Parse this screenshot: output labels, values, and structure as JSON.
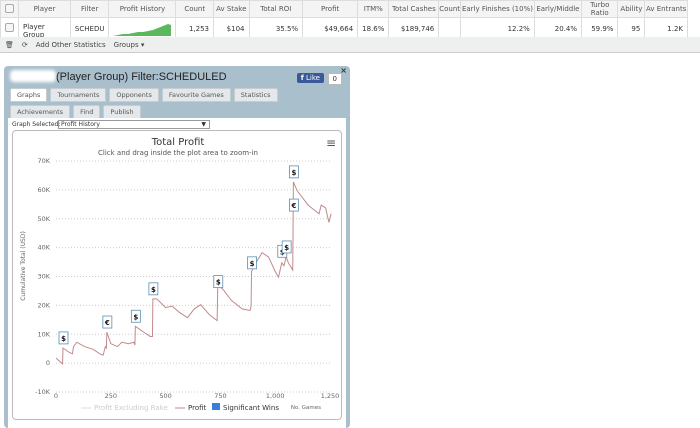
{
  "table": {
    "headers": [
      "",
      "Player",
      "Filter",
      "Profit History",
      "Count",
      "Av Stake",
      "Total ROI",
      "Profit",
      "ITM%",
      "Total Cashes",
      "Count",
      "Early Finishes (10%)",
      "Early/Middle",
      "Turbo Ratio",
      "Ability",
      "Av Entrants"
    ],
    "row": [
      "",
      "Player Group",
      "SCHEDU",
      "",
      "1,253",
      "$104",
      "35.5%",
      "$49,664",
      "18.6%",
      "$189,746",
      "",
      "12.2%",
      "20.4%",
      "59.9%",
      "95",
      "1.2K"
    ]
  },
  "toolbar": {
    "add_stats": "Add Other Statistics",
    "groups": "Groups ▾"
  },
  "popup": {
    "title": "(Player Group) Filter:SCHEDULED",
    "like": "Like",
    "like_count": "0",
    "tabs": [
      "Graphs",
      "Tournaments",
      "Opponents",
      "Favourite Games",
      "Statistics",
      "Achievements",
      "Find",
      "Publish"
    ],
    "graph_label": "Graph Selected:",
    "graph_value": "Profit History"
  },
  "chart_data": {
    "type": "line",
    "title": "Total Profit",
    "subtitle": "Click and drag inside the plot area to zoom-in",
    "ylabel": "Cumulative Total (USD)",
    "xlabel": "No. Games",
    "xlim": [
      0,
      1250
    ],
    "ylim": [
      -10000,
      70000
    ],
    "xticks": [
      "0",
      "250",
      "500",
      "750",
      "1,000",
      "1,250"
    ],
    "yticks": [
      "-10K",
      "0",
      "10K",
      "20K",
      "30K",
      "40K",
      "50K",
      "60K",
      "70K"
    ],
    "legend": [
      "Profit Excluding Rake",
      "Profit",
      "Significant Wins"
    ],
    "legend_placement": "bottom",
    "line_color": "#c08a8a",
    "flag_color": "#3b7dd8",
    "series": [
      {
        "name": "Profit",
        "points": [
          [
            0,
            0
          ],
          [
            30,
            -2000
          ],
          [
            32,
            3500
          ],
          [
            60,
            2000
          ],
          [
            75,
            1500
          ],
          [
            80,
            4000
          ],
          [
            95,
            5500
          ],
          [
            130,
            4000
          ],
          [
            170,
            3000
          ],
          [
            200,
            1500
          ],
          [
            215,
            1000
          ],
          [
            225,
            4000
          ],
          [
            230,
            3500
          ],
          [
            232,
            9000
          ],
          [
            250,
            5000
          ],
          [
            280,
            4000
          ],
          [
            300,
            5500
          ],
          [
            330,
            5000
          ],
          [
            355,
            5500
          ],
          [
            360,
            4500
          ],
          [
            362,
            11000
          ],
          [
            400,
            9000
          ],
          [
            430,
            7500
          ],
          [
            440,
            7500
          ],
          [
            442,
            20500
          ],
          [
            460,
            20500
          ],
          [
            500,
            17500
          ],
          [
            530,
            18000
          ],
          [
            560,
            16000
          ],
          [
            600,
            14000
          ],
          [
            630,
            17000
          ],
          [
            660,
            18500
          ],
          [
            700,
            15000
          ],
          [
            735,
            13000
          ],
          [
            738,
            25000
          ],
          [
            760,
            24000
          ],
          [
            800,
            20000
          ],
          [
            850,
            17000
          ],
          [
            885,
            16500
          ],
          [
            890,
            18000
          ],
          [
            892,
            30000
          ],
          [
            920,
            34000
          ],
          [
            940,
            36500
          ],
          [
            970,
            35000
          ],
          [
            1000,
            30000
          ],
          [
            1015,
            28000
          ],
          [
            1030,
            33000
          ],
          [
            1040,
            32000
          ],
          [
            1050,
            35000
          ],
          [
            1060,
            33000
          ],
          [
            1080,
            30500
          ],
          [
            1083,
            61000
          ],
          [
            1100,
            58000
          ],
          [
            1130,
            55000
          ],
          [
            1150,
            53000
          ],
          [
            1200,
            50000
          ],
          [
            1210,
            53000
          ],
          [
            1230,
            52000
          ],
          [
            1245,
            47000
          ],
          [
            1255,
            50000
          ]
        ]
      }
    ],
    "flags": [
      {
        "x": 32,
        "y": 7000,
        "text": "$"
      },
      {
        "x": 232,
        "y": 12500,
        "text": "€"
      },
      {
        "x": 362,
        "y": 14500,
        "text": "$"
      },
      {
        "x": 442,
        "y": 24000,
        "text": "$"
      },
      {
        "x": 738,
        "y": 26500,
        "text": "$"
      },
      {
        "x": 892,
        "y": 33000,
        "text": "$"
      },
      {
        "x": 1030,
        "y": 37000,
        "text": "$"
      },
      {
        "x": 1050,
        "y": 38500,
        "text": "$"
      },
      {
        "x": 1083,
        "y": 53000,
        "text": "€"
      },
      {
        "x": 1083,
        "y": 64500,
        "text": "$"
      }
    ]
  }
}
